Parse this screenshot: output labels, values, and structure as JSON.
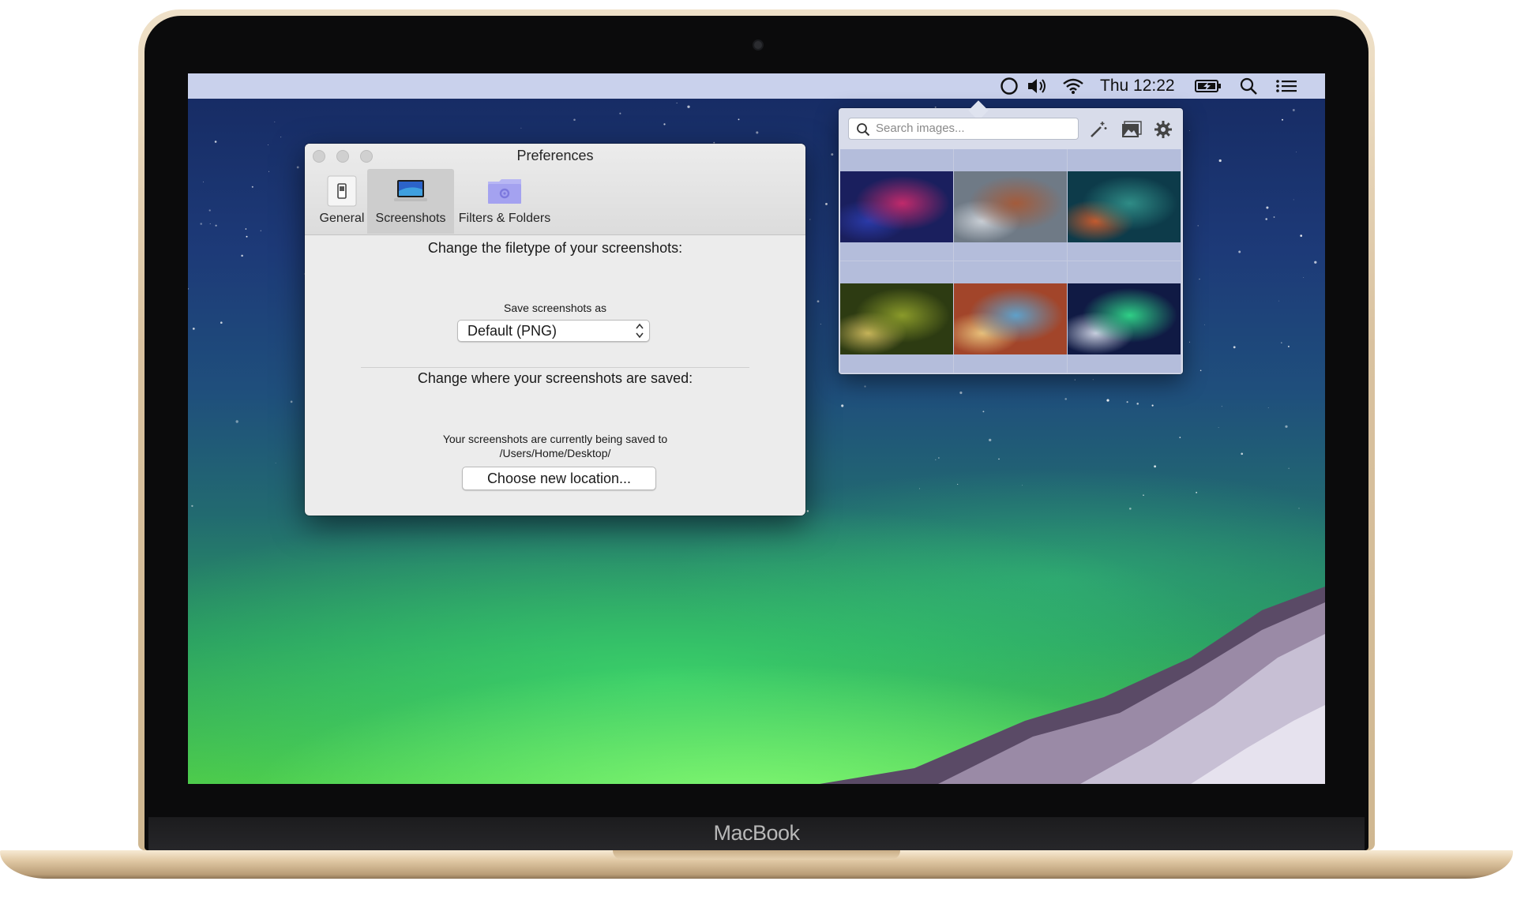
{
  "device": {
    "brand": "MacBook"
  },
  "menubar": {
    "time": "Thu 12:22",
    "icons": [
      "app-circle-icon",
      "volume-icon",
      "wifi-icon",
      "battery-charging-icon",
      "spotlight-search-icon",
      "notification-center-icon"
    ]
  },
  "preferences": {
    "title": "Preferences",
    "tabs": [
      {
        "label": "General",
        "icon": "switch-icon",
        "selected": false
      },
      {
        "label": "Screenshots",
        "icon": "laptop-icon",
        "selected": true
      },
      {
        "label": "Filters & Folders",
        "icon": "gear-folder-icon",
        "selected": false
      }
    ],
    "filetype": {
      "heading": "Change the filetype of your screenshots:",
      "label": "Save screenshots as",
      "value": "Default (PNG)"
    },
    "location": {
      "heading": "Change where your screenshots are saved:",
      "line1": "Your screenshots are currently being saved to",
      "path": "/Users/Home/Desktop/",
      "button": "Choose new location..."
    }
  },
  "popover": {
    "search_placeholder": "Search images...",
    "tools": [
      "magic-wand-icon",
      "image-icon",
      "gear-icon"
    ],
    "thumbnails": [
      {
        "name": "galaxy-nebula",
        "colors": [
          "#1a1f5e",
          "#c02a6b",
          "#2a3aa8"
        ]
      },
      {
        "name": "aerial-church",
        "colors": [
          "#6f7a86",
          "#a35b3b",
          "#c9cfd6"
        ]
      },
      {
        "name": "teal-nebula",
        "colors": [
          "#0d3b4a",
          "#2f8c86",
          "#c45a2e"
        ]
      },
      {
        "name": "forest",
        "colors": [
          "#2d3b12",
          "#8a9a2a",
          "#c7b45a"
        ]
      },
      {
        "name": "orion-nebula",
        "colors": [
          "#a2452a",
          "#5fa0c9",
          "#e8c07a"
        ]
      },
      {
        "name": "aurora-landscape",
        "colors": [
          "#101a44",
          "#2fcf86",
          "#c8cedf"
        ]
      }
    ]
  }
}
